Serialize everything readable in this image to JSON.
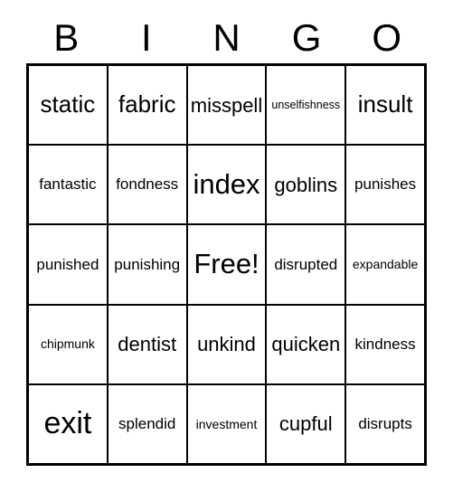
{
  "card": {
    "header_letters": [
      "B",
      "I",
      "N",
      "G",
      "O"
    ],
    "free_space_label": "Free!",
    "colors": {
      "background": "#ffffff",
      "border": "#000000",
      "text": "#000000"
    },
    "grid": {
      "columns": 5,
      "rows": 5,
      "cells": [
        [
          {
            "label": "static",
            "size": "fs-l"
          },
          {
            "label": "fabric",
            "size": "fs-l"
          },
          {
            "label": "misspell",
            "size": "fs-m"
          },
          {
            "label": "unselfishness",
            "size": "fs-xxs"
          },
          {
            "label": "insult",
            "size": "fs-l"
          }
        ],
        [
          {
            "label": "fantastic",
            "size": "fs-s"
          },
          {
            "label": "fondness",
            "size": "fs-s"
          },
          {
            "label": "index",
            "size": "fs-xl"
          },
          {
            "label": "goblins",
            "size": "fs-m"
          },
          {
            "label": "punishes",
            "size": "fs-s"
          }
        ],
        [
          {
            "label": "punished",
            "size": "fs-s"
          },
          {
            "label": "punishing",
            "size": "fs-s"
          },
          {
            "label": "Free!",
            "size": "fs-xl"
          },
          {
            "label": "disrupted",
            "size": "fs-s"
          },
          {
            "label": "expandable",
            "size": "fs-xs"
          }
        ],
        [
          {
            "label": "chipmunk",
            "size": "fs-xs"
          },
          {
            "label": "dentist",
            "size": "fs-m"
          },
          {
            "label": "unkind",
            "size": "fs-m"
          },
          {
            "label": "quicken",
            "size": "fs-m"
          },
          {
            "label": "kindness",
            "size": "fs-s"
          }
        ],
        [
          {
            "label": "exit",
            "size": "fs-xxl"
          },
          {
            "label": "splendid",
            "size": "fs-s"
          },
          {
            "label": "investment",
            "size": "fs-xs"
          },
          {
            "label": "cupful",
            "size": "fs-m"
          },
          {
            "label": "disrupts",
            "size": "fs-s"
          }
        ]
      ]
    }
  }
}
